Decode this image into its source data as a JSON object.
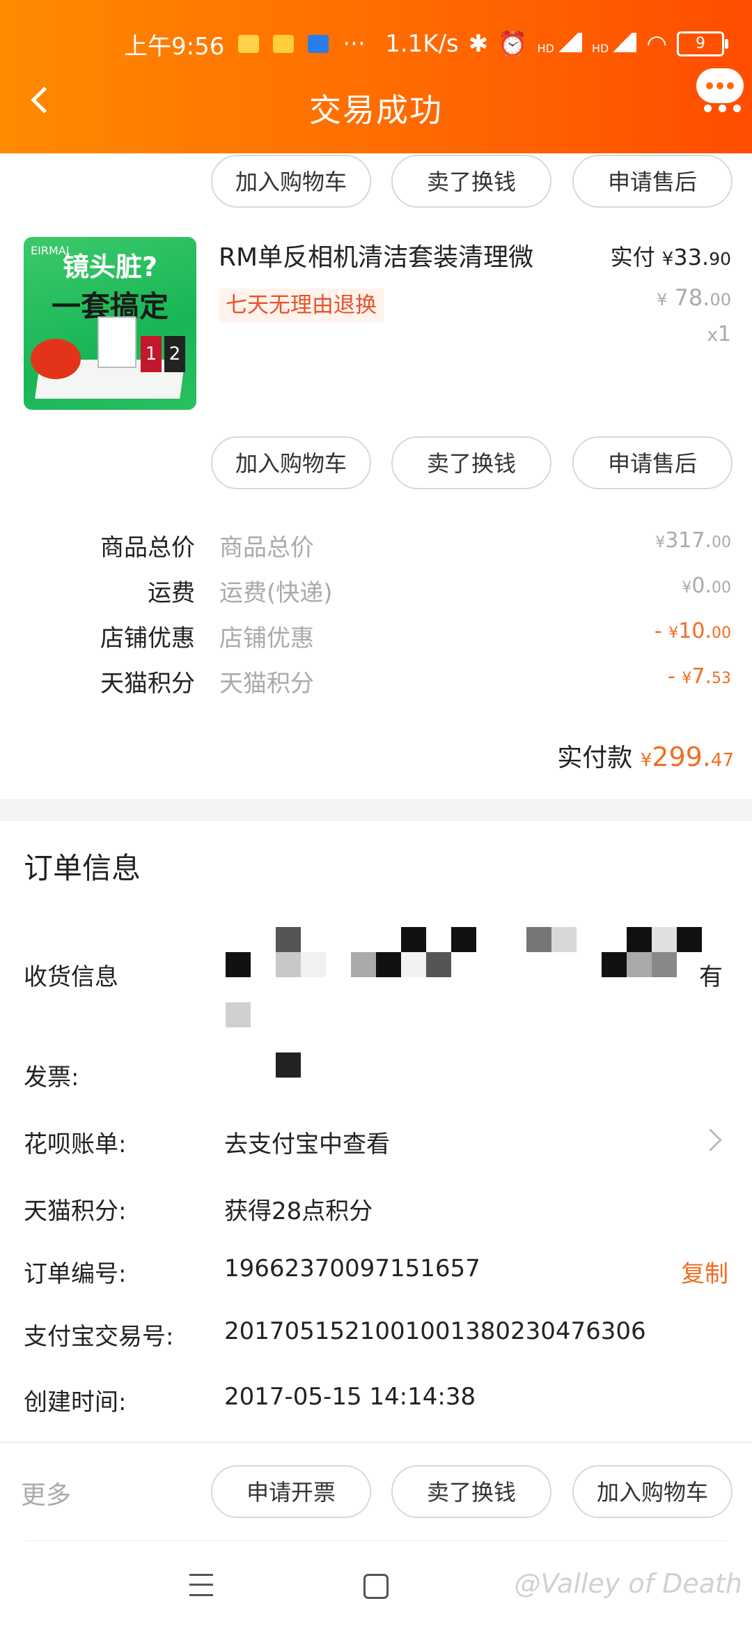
{
  "status_bar": {
    "time": "上午9:56",
    "more": "···",
    "net_speed": "1.1K/s",
    "hd": "HD",
    "battery": "9"
  },
  "header": {
    "title": "交易成功"
  },
  "item1": {
    "buttons": [
      "加入购物车",
      "卖了换钱",
      "申请售后"
    ]
  },
  "item2": {
    "image_text_top": "镜头脏?",
    "image_text_bottom": "一套搞定",
    "image_brand": "EIRMAI",
    "image_card_1": "1",
    "image_card_2": "2",
    "title": "RM单反相机清洁套装清理微",
    "tag": "七天无理由退换",
    "paid_label": "实付",
    "paid_currency": "¥",
    "paid_int": "33.",
    "paid_dec": "90",
    "orig_currency": "¥",
    "orig_int": "78.",
    "orig_dec": "00",
    "qty_x": "x",
    "qty": "1",
    "buttons": [
      "加入购物车",
      "卖了换钱",
      "申请售后"
    ]
  },
  "summary": {
    "rows": [
      {
        "label": "商品总价",
        "sub": "商品总价",
        "sign": "",
        "cur": "¥",
        "int": "317.",
        "dec": "00"
      },
      {
        "label": "运费",
        "sub": "运费(快递)",
        "sign": "",
        "cur": "¥",
        "int": "0.",
        "dec": "00"
      },
      {
        "label": "店铺优惠",
        "sub": "店铺优惠",
        "sign": "- ",
        "cur": "¥",
        "int": "10.",
        "dec": "00"
      },
      {
        "label": "天猫积分",
        "sub": "天猫积分",
        "sign": "- ",
        "cur": "¥",
        "int": "7.",
        "dec": "53"
      }
    ],
    "total_label": "实付款",
    "total_cur": "¥",
    "total_int": "299.",
    "total_dec": "47"
  },
  "order_info": {
    "title": "订单信息",
    "shipping_label": "收货信息",
    "shipping_tail": "有",
    "invoice_label": "发票:",
    "huabei_label": "花呗账单:",
    "huabei_value": "去支付宝中查看",
    "points_label": "天猫积分:",
    "points_value": "获得28点积分",
    "order_no_label": "订单编号:",
    "order_no": "19662370097151657",
    "copy_label": "复制",
    "alipay_label": "支付宝交易号:",
    "alipay_no": "2017051521001001380230476306",
    "created_label": "创建时间:",
    "created_value": "2017-05-15 14:14:38"
  },
  "bottom_bar": {
    "more_label": "更多",
    "buttons": [
      "申请开票",
      "卖了换钱",
      "加入购物车"
    ]
  },
  "watermark": "@Valley of Death",
  "colors": {
    "header_orange": "#ff6a00",
    "accent": "#f06d21"
  }
}
